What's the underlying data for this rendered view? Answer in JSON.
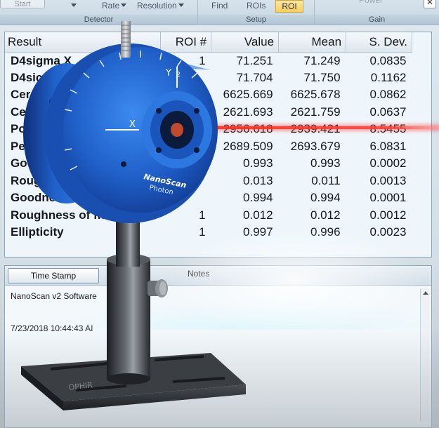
{
  "ribbon": {
    "start_label": "Start",
    "rate_label": "Rate",
    "resolution_label": "Resolution",
    "find_label": "Find",
    "rois_label": "ROIs",
    "roi_label": "ROI",
    "power_label": "Power",
    "groups": {
      "detector": "Detector",
      "setup": "Setup",
      "gain": "Gain"
    }
  },
  "results": {
    "headers": [
      "Result",
      "ROI #",
      "Value",
      "Mean",
      "S. Dev."
    ],
    "rows": [
      {
        "result": "D4sigma X",
        "roi": "1",
        "value": "71.251",
        "mean": "71.249",
        "sdev": "0.0835"
      },
      {
        "result": "D4sic",
        "roi": "",
        "value": "71.704",
        "mean": "71.750",
        "sdev": "0.1162"
      },
      {
        "result": "Cer",
        "roi": "",
        "value": "6625.669",
        "mean": "6625.678",
        "sdev": "0.0862"
      },
      {
        "result": "Ce",
        "roi": "",
        "value": "2621.693",
        "mean": "2621.759",
        "sdev": "0.0637"
      },
      {
        "result": "Po",
        "roi": "",
        "value": "2956.618",
        "mean": "2939.421",
        "sdev": "8.5455"
      },
      {
        "result": "Pe",
        "roi": "",
        "value": "2689.509",
        "mean": "2693.679",
        "sdev": "6.0831"
      },
      {
        "result": "Go",
        "roi": "",
        "value": "0.993",
        "mean": "0.993",
        "sdev": "0.0002"
      },
      {
        "result": "Roug",
        "roi": "",
        "value": "0.013",
        "mean": "0.011",
        "sdev": "0.0013"
      },
      {
        "result": "Goodnes",
        "roi": "",
        "value": "0.994",
        "mean": "0.994",
        "sdev": "0.0001"
      },
      {
        "result": "Roughness of fit",
        "roi": "1",
        "value": "0.012",
        "mean": "0.012",
        "sdev": "0.0012"
      },
      {
        "result": "Ellipticity",
        "roi": "1",
        "value": "0.997",
        "mean": "0.996",
        "sdev": "0.0023"
      }
    ]
  },
  "notes": {
    "timestamp_button": "Time Stamp",
    "title": "Notes",
    "line1": "NanoScan v2 Software",
    "line2": "7/23/2018 10:44:43 AI"
  },
  "device": {
    "brand": "NanoScan",
    "sub_brand": "Photon",
    "base_brand": "OPHIR",
    "axis_x": "X",
    "axis_y": "Y",
    "axis_y2": "2"
  },
  "colors": {
    "device_blue": "#1f5fc8",
    "laser_red": "#ff2a1e",
    "roi_active": "#f6cf5b"
  }
}
